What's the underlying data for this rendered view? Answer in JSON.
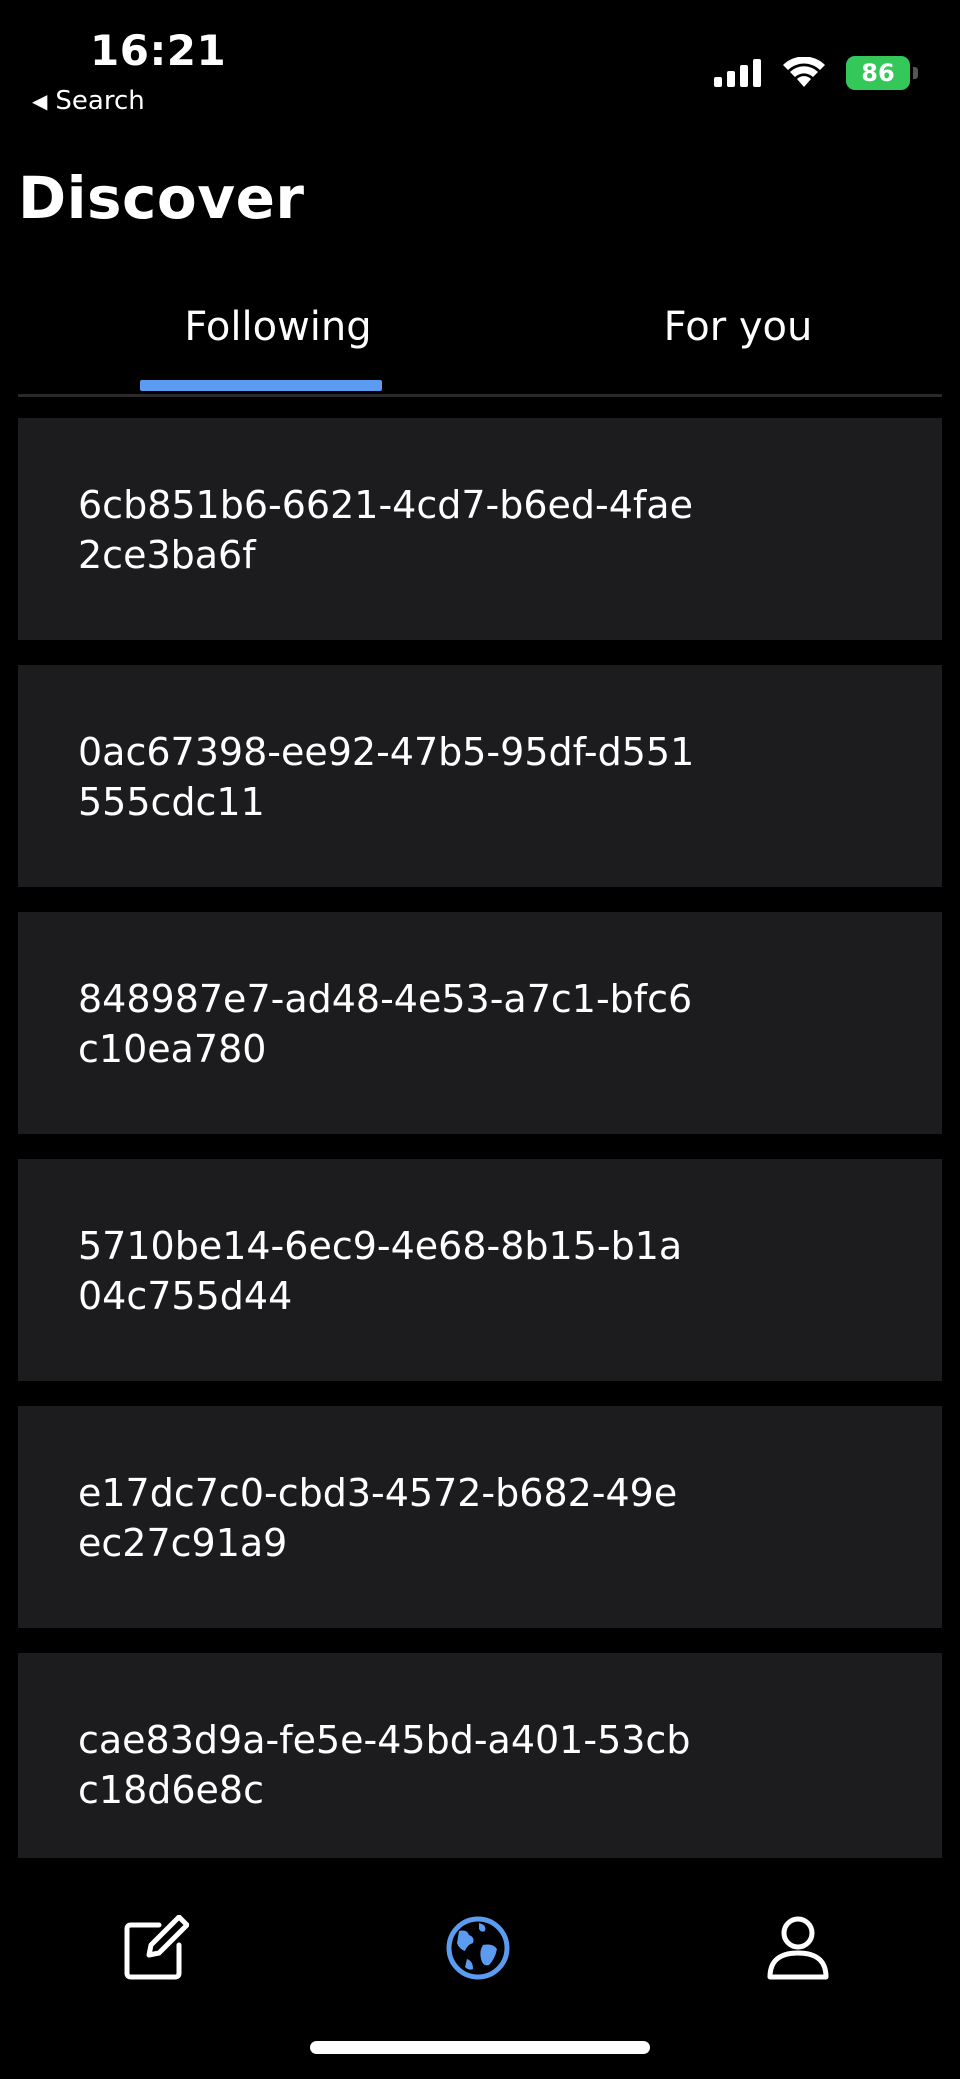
{
  "status_bar": {
    "time": "16:21",
    "back_label": "Search",
    "battery": "86"
  },
  "header": {
    "title": "Discover"
  },
  "tabs": [
    {
      "label": "Following",
      "active": true
    },
    {
      "label": "For you",
      "active": false
    }
  ],
  "items": [
    {
      "text": "6cb851b6-6621-4cd7-b6ed-4fae2ce3ba6f"
    },
    {
      "text": "0ac67398-ee92-47b5-95df-d551555cdc11"
    },
    {
      "text": "848987e7-ad48-4e53-a7c1-bfc6c10ea780"
    },
    {
      "text": "5710be14-6ec9-4e68-8b15-b1a04c755d44"
    },
    {
      "text": "e17dc7c0-cbd3-4572-b682-49eec27c91a9"
    },
    {
      "text": "cae83d9a-fe5e-45bd-a401-53cbc18d6e8c"
    }
  ],
  "nav": {
    "items": [
      {
        "icon": "compose-icon"
      },
      {
        "icon": "globe-icon",
        "active": true
      },
      {
        "icon": "person-icon"
      }
    ]
  },
  "colors": {
    "accent": "#5b9cf0",
    "card_bg": "#1c1c1e",
    "battery": "#34c759"
  }
}
